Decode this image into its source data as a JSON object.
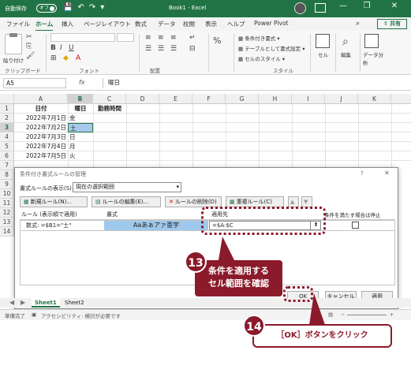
{
  "titlebar": {
    "autosave_label": "自動保存",
    "autosave_state": "オフ",
    "window_title": "Book1 - Excel",
    "minimize": "—",
    "restore": "❐",
    "close": "✕"
  },
  "ribbon_tabs": [
    "ファイル",
    "ホーム",
    "挿入",
    "ページレイアウト",
    "数式",
    "データ",
    "校閲",
    "表示",
    "ヘルプ",
    "Power Pivot"
  ],
  "active_tab": "ホーム",
  "share_label": "共有",
  "ribbon": {
    "paste_label": "貼り付け",
    "groups": [
      "クリップボード",
      "フォント",
      "配置",
      "スタイル"
    ],
    "styles_items": [
      "条件付き書式",
      "テーブルとして書式設定",
      "セルのスタイル"
    ],
    "cells_label": "セル",
    "editing_label": "編集",
    "analyze_label": "データ分析"
  },
  "formula_bar": {
    "name_box": "A5",
    "fx": "fx",
    "content": "曜日"
  },
  "grid": {
    "columns": [
      "A",
      "B",
      "C",
      "D",
      "E",
      "F",
      "G",
      "H",
      "I",
      "J",
      "K"
    ],
    "rows": [
      "1",
      "2",
      "3",
      "4",
      "5",
      "6",
      "7",
      "8",
      "9",
      "10",
      "11",
      "12",
      "13",
      "14"
    ],
    "row1": [
      "日付",
      "曜日",
      "勤務時間"
    ],
    "data": [
      {
        "date": "2022年7月1日",
        "day": "金"
      },
      {
        "date": "2022年7月2日",
        "day": "土"
      },
      {
        "date": "2022年7月3日",
        "day": "日"
      },
      {
        "date": "2022年7月4日",
        "day": "月"
      },
      {
        "date": "2022年7月5日",
        "day": "火"
      }
    ]
  },
  "dialog": {
    "title": "条件付き書式ルールの管理",
    "help": "?",
    "close": "✕",
    "show_rules_label": "書式ルールの表示(S):",
    "show_rules_value": "現在の選択範囲",
    "buttons": {
      "new_rule": "新規ルール(N)...",
      "edit_rule": "ルールの編集(E)...",
      "delete_rule": "ルールの削除(D)",
      "duplicate_rule": "重複ルール(C)",
      "move_up": "▲",
      "move_down": "▼"
    },
    "headers": {
      "rule": "ルール (表示順で適用)",
      "format": "書式",
      "applies_to": "適用先",
      "stop_if_true": "条件を満たす場合は停止"
    },
    "rule_row": {
      "rule": "数式: =$B1=\"土\"",
      "preview": "Aaあぁアァ亜宇",
      "applies_to": "=$A:$C",
      "collapse_icon": "⬆"
    },
    "ok": "OK",
    "cancel": "キャンセル",
    "apply": "適用"
  },
  "sheet_tabs": [
    "Sheet1",
    "Sheet2"
  ],
  "status": {
    "ready": "準備完了",
    "accessibility": "アクセシビリティ: 検討が必要です"
  },
  "callouts": {
    "step13_number": "13",
    "step13_text_line1": "条件を適用する",
    "step13_text_line2": "セル範囲を確認",
    "step14_number": "14",
    "step14_text": "［OK］ボタンをクリック"
  },
  "colors": {
    "excel_green": "#217346",
    "callout_red": "#8b1a2a",
    "format_preview": "#9fc9ec"
  }
}
